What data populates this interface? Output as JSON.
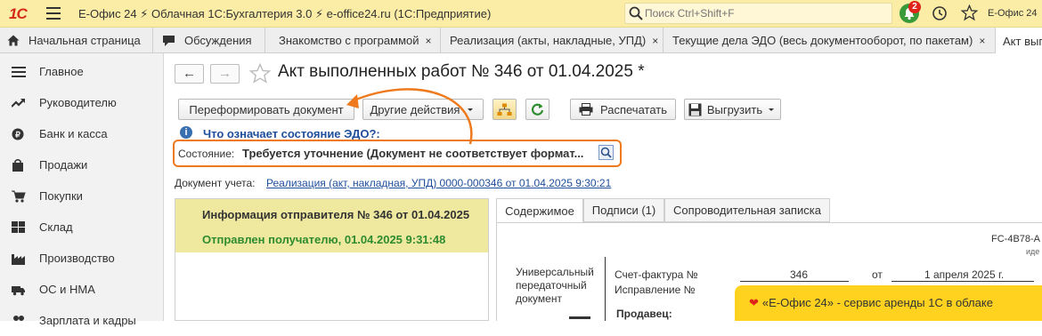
{
  "titlebar": {
    "logo": "1С",
    "title": "Е-Офис 24 ⚡ Облачная 1С:Бухгалтерия 3.0 ⚡ e-office24.ru  (1С:Предприятие)",
    "search_placeholder": "Поиск Ctrl+Shift+F",
    "notifications_count": "2",
    "user": "Е-Офис 24"
  },
  "tabs": [
    {
      "label": "Начальная страница"
    },
    {
      "label": "Обсуждения"
    },
    {
      "label": "Знакомство с программой",
      "close": "×"
    },
    {
      "label": "Реализация (акты, накладные, УПД)",
      "close": "×"
    },
    {
      "label": "Текущие дела ЭДО (весь документооборот, по пакетам)",
      "close": "×"
    },
    {
      "label": "Акт вып"
    }
  ],
  "sidebar": {
    "items": [
      {
        "label": "Главное"
      },
      {
        "label": "Руководителю"
      },
      {
        "label": "Банк и касса"
      },
      {
        "label": "Продажи"
      },
      {
        "label": "Покупки"
      },
      {
        "label": "Склад"
      },
      {
        "label": "Производство"
      },
      {
        "label": "ОС и НМА"
      },
      {
        "label": "Зарплата и кадры"
      }
    ]
  },
  "document": {
    "back": "←",
    "forward": "→",
    "title": "Акт выполненных работ № 346 от 01.04.2025 *",
    "toolbar": {
      "reformat": "Переформировать документ",
      "other_actions": "Другие действия",
      "print": "Распечатать",
      "export": "Выгрузить"
    },
    "edo_link": "Что означает состояние ЭДО?:",
    "status_label": "Состояние:",
    "status_value": "Требуется уточнение (Документ не соответствует формат...",
    "account_label": "Документ учета:",
    "account_link": "Реализация (акт, накладная, УПД) 0000-000346 от 01.04.2025 9:30:21",
    "sender_title": "Информация отправителя № 346 от 01.04.2025",
    "sender_status": "Отправлен получателю, 01.04.2025 9:31:48",
    "detail_tabs": [
      "Содержимое",
      "Подписи (1)",
      "Сопроводительная записка"
    ],
    "upd": {
      "id_fragment": "FC-4B78-A",
      "id_caption": "иде",
      "doc_name": "Универсальный\nпередаточный\nдокумент",
      "invoice_label": "Счет-фактура №",
      "invoice_number": "346",
      "from": "от",
      "invoice_date": "1 апреля 2025 г.",
      "correction_label": "Исправление №",
      "seller_label": "Продавец:"
    }
  },
  "promo": {
    "heart": "❤",
    "text": "«Е-Офис 24» - сервис аренды 1С в облаке"
  },
  "colors": {
    "titlebar": "#fbeda6",
    "highlight_orange": "#ee7a1d",
    "sender_band": "#efe9a0",
    "sent_green": "#2e8b2e",
    "promo_yellow": "#ffd21f",
    "link_blue": "#1f4e9c"
  }
}
